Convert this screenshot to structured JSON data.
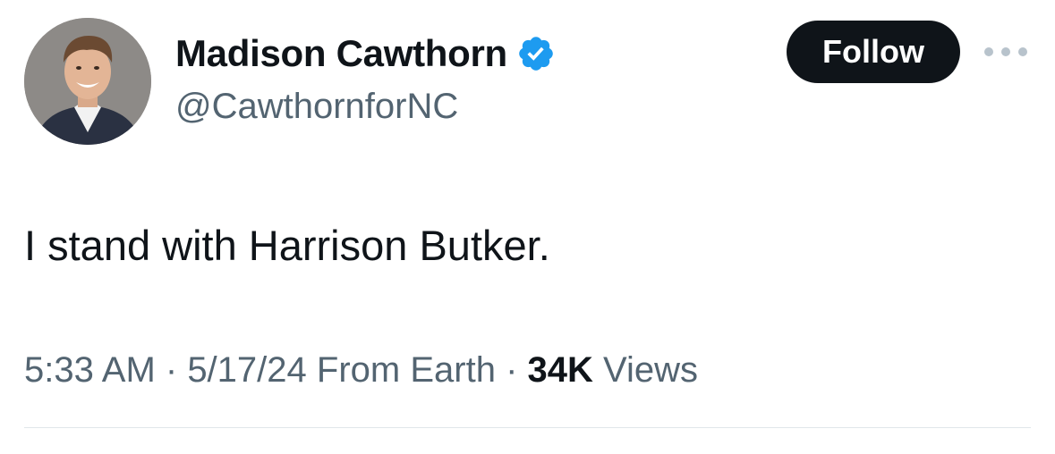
{
  "author": {
    "display_name": "Madison Cawthorn",
    "handle": "@CawthornforNC",
    "verified": true,
    "verified_color": "#1d9bf0",
    "avatar_icon": "profile-photo"
  },
  "actions": {
    "follow_label": "Follow",
    "more_icon": "more-dots-icon"
  },
  "tweet": {
    "text": "I stand with Harrison Butker."
  },
  "meta": {
    "time": "5:33 AM",
    "separator": " · ",
    "date": "5/17/24",
    "source": "From Earth",
    "views_count": "34K",
    "views_label": "Views"
  },
  "colors": {
    "text": "#0f1419",
    "secondary": "#536471",
    "button_bg": "#0f1419",
    "button_text": "#ffffff"
  }
}
